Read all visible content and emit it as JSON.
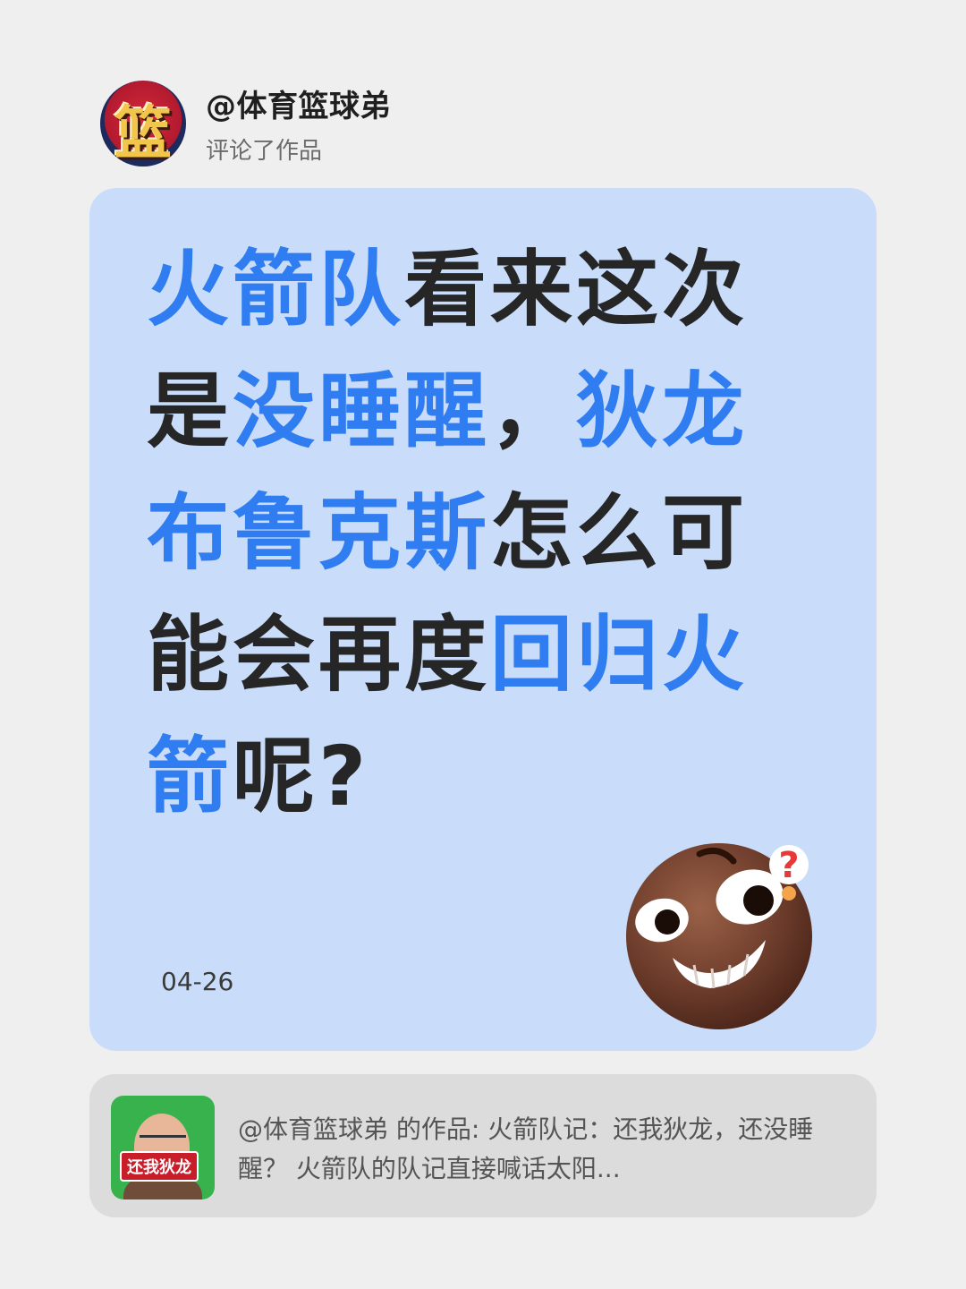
{
  "post": {
    "username": "@体育篮球弟",
    "action": "评论了作品",
    "avatar_text": "篮"
  },
  "comment": {
    "lines": [
      [
        {
          "t": "火箭队",
          "hl": true
        },
        {
          "t": "看来这次",
          "hl": false
        }
      ],
      [
        {
          "t": "是",
          "hl": false
        },
        {
          "t": "没睡醒",
          "hl": true
        },
        {
          "t": "，",
          "hl": false
        },
        {
          "t": "狄龙",
          "hl": true
        }
      ],
      [
        {
          "t": "布鲁克斯",
          "hl": true
        },
        {
          "t": "怎么可",
          "hl": false
        }
      ],
      [
        {
          "t": "能会再度",
          "hl": false
        },
        {
          "t": "回归火",
          "hl": true
        }
      ],
      [
        {
          "t": "箭",
          "hl": true
        },
        {
          "t": "呢?",
          "hl": false
        }
      ]
    ],
    "date": "04-26",
    "emoji": "thinking-smile-question-emoji"
  },
  "reference": {
    "thumb_tag": "还我狄龙",
    "text": "@体育篮球弟 的作品: 火箭队记：还我狄龙，还没睡醒？ 火箭队的队记直接喊话太阳..."
  },
  "colors": {
    "background": "#efefef",
    "card": "#c9ddfb",
    "highlight": "#2f7df0",
    "text": "#262626",
    "ref_card": "#dcdcdc"
  }
}
